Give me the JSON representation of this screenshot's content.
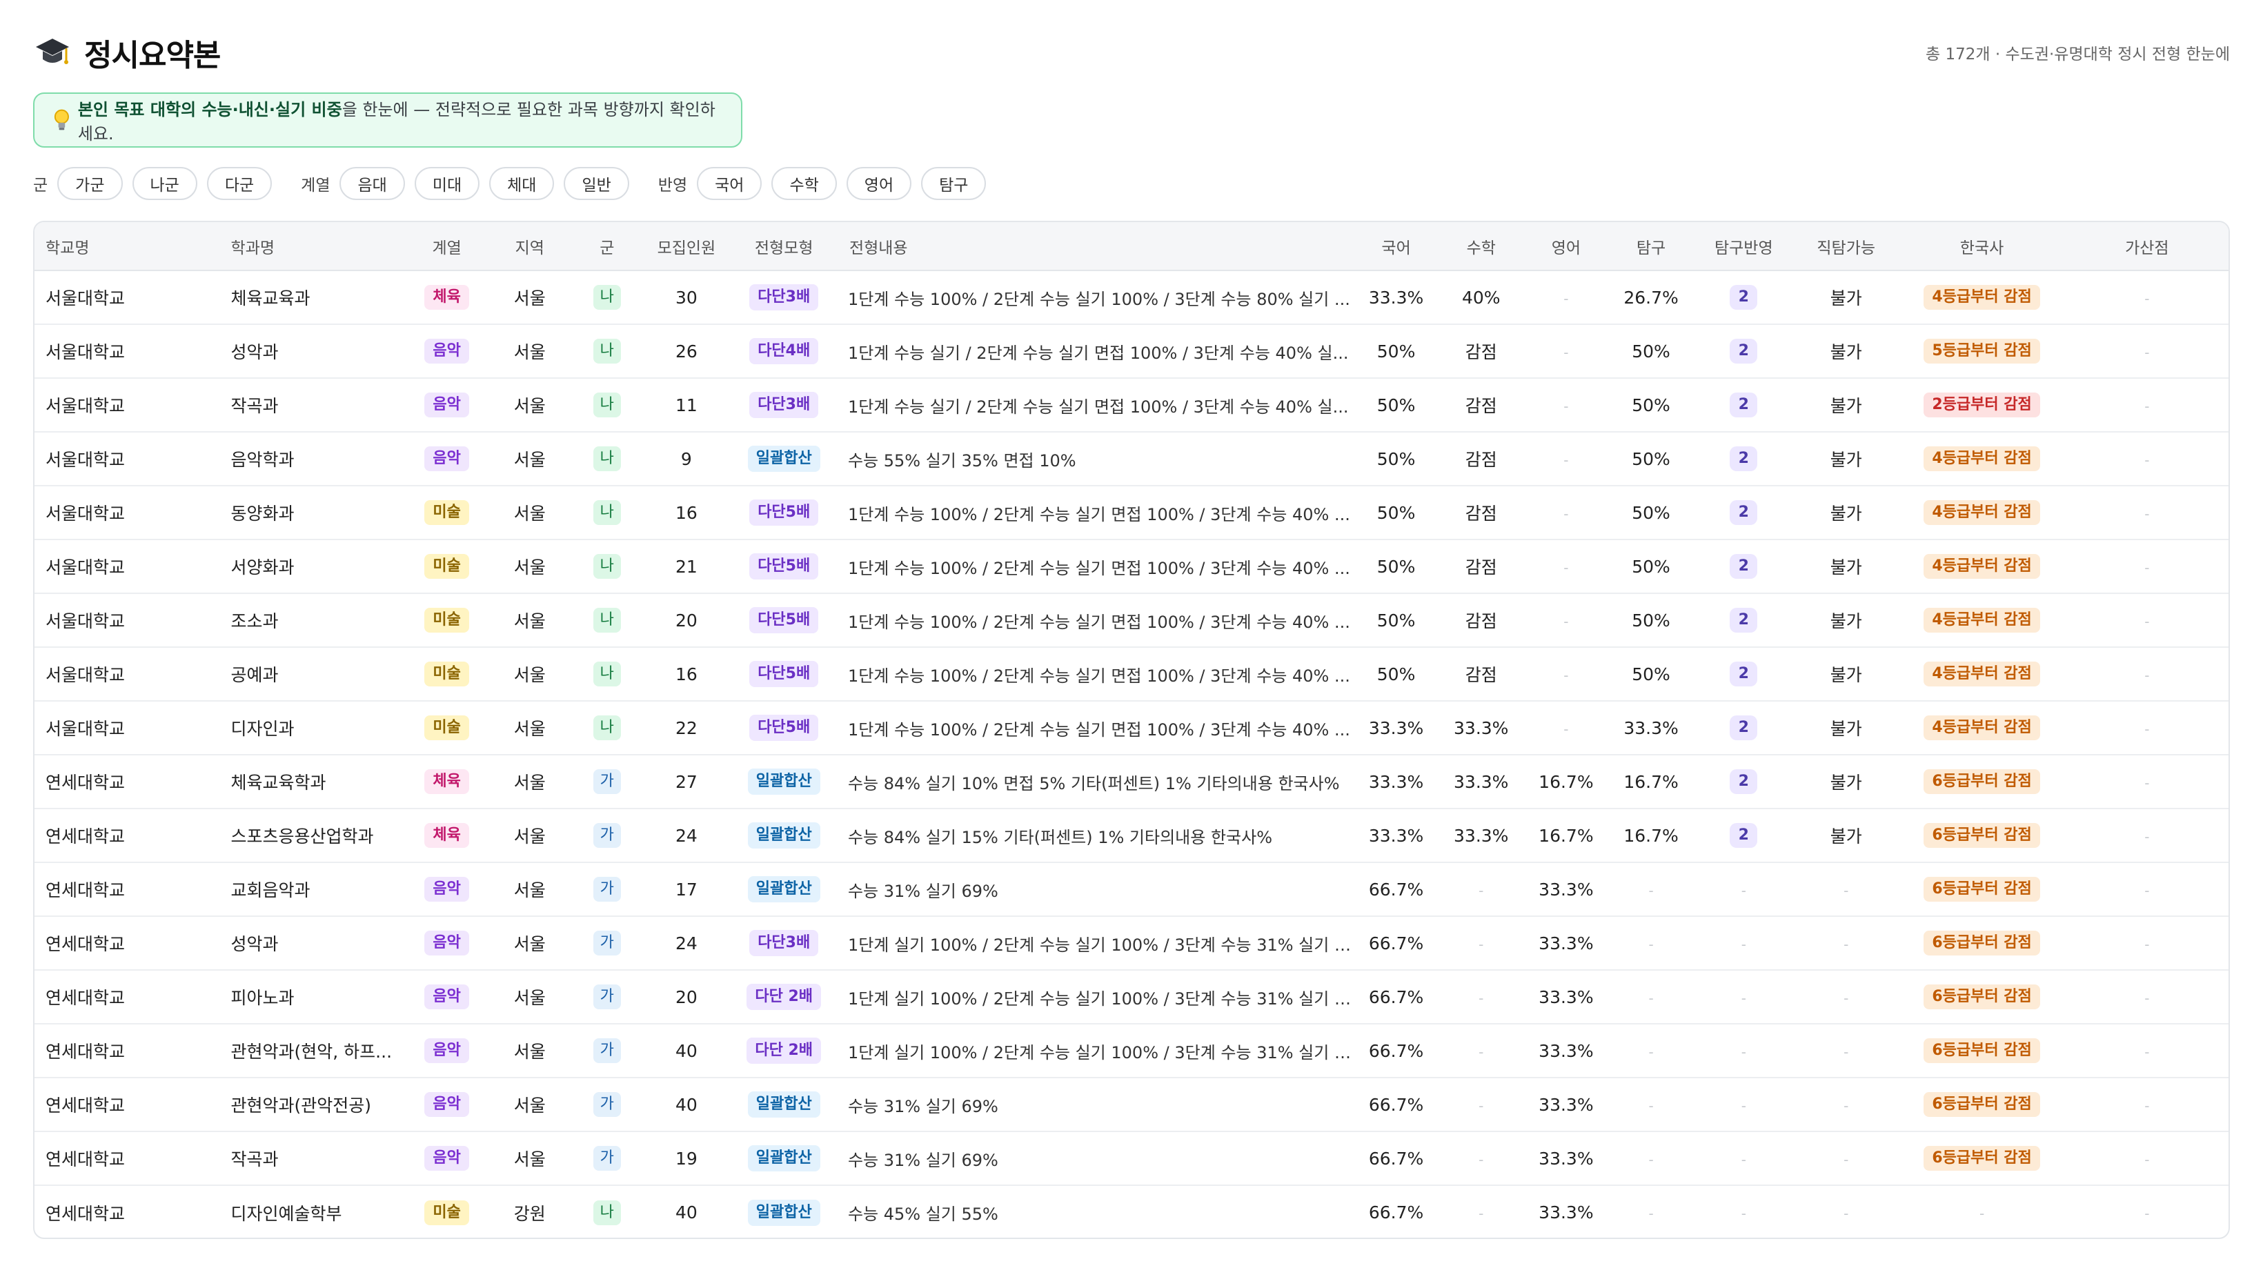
{
  "header": {
    "icon": "graduation-cap-icon",
    "title": "정시요약본",
    "summary": "총 172개 · 수도권·유명대학 정시 전형 한눈에"
  },
  "tip": {
    "icon": "lightbulb-icon",
    "bold": "본인 목표 대학의 수능·내신·실기 비중",
    "rest": "을 한눈에 — 전략적으로 필요한 과목 방향까지 확인하세요."
  },
  "filters": {
    "gun_label": "군",
    "gun": [
      "가군",
      "나군",
      "다군"
    ],
    "field_label": "계열",
    "field": [
      "음대",
      "미대",
      "체대",
      "일반"
    ],
    "reflect_label": "반영",
    "reflect": [
      "국어",
      "수학",
      "영어",
      "탐구"
    ]
  },
  "columns": [
    "학교명",
    "학과명",
    "계열",
    "지역",
    "군",
    "모집인원",
    "전형모형",
    "전형내용",
    "국어",
    "수학",
    "영어",
    "탐구",
    "탐구반영",
    "직탐가능",
    "한국사",
    "가산점"
  ],
  "rows": [
    {
      "school": "서울대학교",
      "dept": "체육교육과",
      "field": "체육",
      "region": "서울",
      "gun": "나",
      "quota": "30",
      "model": "다단3배",
      "desc": "1단계 수능 100% / 2단계 수능 실기 100% / 3단계 수능 80% 실기 ...",
      "kor": "33.3%",
      "math": "40%",
      "eng": "-",
      "inq": "26.7%",
      "inq_n": "2",
      "voc": "불가",
      "hist": "4등급부터 감점",
      "bonus": "-"
    },
    {
      "school": "서울대학교",
      "dept": "성악과",
      "field": "음악",
      "region": "서울",
      "gun": "나",
      "quota": "26",
      "model": "다단4배",
      "desc": "1단계 수능 실기 / 2단계 수능 실기 면접 100% / 3단계 수능 40% 실...",
      "kor": "50%",
      "math": "감점",
      "eng": "-",
      "inq": "50%",
      "inq_n": "2",
      "voc": "불가",
      "hist": "5등급부터 감점",
      "bonus": "-"
    },
    {
      "school": "서울대학교",
      "dept": "작곡과",
      "field": "음악",
      "region": "서울",
      "gun": "나",
      "quota": "11",
      "model": "다단3배",
      "desc": "1단계 수능 실기 / 2단계 수능 실기 면접 100% / 3단계 수능 40% 실...",
      "kor": "50%",
      "math": "감점",
      "eng": "-",
      "inq": "50%",
      "inq_n": "2",
      "voc": "불가",
      "hist": "2등급부터 감점",
      "bonus": "-"
    },
    {
      "school": "서울대학교",
      "dept": "음악학과",
      "field": "음악",
      "region": "서울",
      "gun": "나",
      "quota": "9",
      "model": "일괄합산",
      "desc": "수능 55% 실기 35% 면접 10%",
      "kor": "50%",
      "math": "감점",
      "eng": "-",
      "inq": "50%",
      "inq_n": "2",
      "voc": "불가",
      "hist": "4등급부터 감점",
      "bonus": "-"
    },
    {
      "school": "서울대학교",
      "dept": "동양화과",
      "field": "미술",
      "region": "서울",
      "gun": "나",
      "quota": "16",
      "model": "다단5배",
      "desc": "1단계 수능 100% / 2단계 수능 실기 면접 100% / 3단계 수능 40% ...",
      "kor": "50%",
      "math": "감점",
      "eng": "-",
      "inq": "50%",
      "inq_n": "2",
      "voc": "불가",
      "hist": "4등급부터 감점",
      "bonus": "-"
    },
    {
      "school": "서울대학교",
      "dept": "서양화과",
      "field": "미술",
      "region": "서울",
      "gun": "나",
      "quota": "21",
      "model": "다단5배",
      "desc": "1단계 수능 100% / 2단계 수능 실기 면접 100% / 3단계 수능 40% ...",
      "kor": "50%",
      "math": "감점",
      "eng": "-",
      "inq": "50%",
      "inq_n": "2",
      "voc": "불가",
      "hist": "4등급부터 감점",
      "bonus": "-"
    },
    {
      "school": "서울대학교",
      "dept": "조소과",
      "field": "미술",
      "region": "서울",
      "gun": "나",
      "quota": "20",
      "model": "다단5배",
      "desc": "1단계 수능 100% / 2단계 수능 실기 면접 100% / 3단계 수능 40% ...",
      "kor": "50%",
      "math": "감점",
      "eng": "-",
      "inq": "50%",
      "inq_n": "2",
      "voc": "불가",
      "hist": "4등급부터 감점",
      "bonus": "-"
    },
    {
      "school": "서울대학교",
      "dept": "공예과",
      "field": "미술",
      "region": "서울",
      "gun": "나",
      "quota": "16",
      "model": "다단5배",
      "desc": "1단계 수능 100% / 2단계 수능 실기 면접 100% / 3단계 수능 40% ...",
      "kor": "50%",
      "math": "감점",
      "eng": "-",
      "inq": "50%",
      "inq_n": "2",
      "voc": "불가",
      "hist": "4등급부터 감점",
      "bonus": "-"
    },
    {
      "school": "서울대학교",
      "dept": "디자인과",
      "field": "미술",
      "region": "서울",
      "gun": "나",
      "quota": "22",
      "model": "다단5배",
      "desc": "1단계 수능 100% / 2단계 수능 실기 면접 100% / 3단계 수능 40% ...",
      "kor": "33.3%",
      "math": "33.3%",
      "eng": "-",
      "inq": "33.3%",
      "inq_n": "2",
      "voc": "불가",
      "hist": "4등급부터 감점",
      "bonus": "-"
    },
    {
      "school": "연세대학교",
      "dept": "체육교육학과",
      "field": "체육",
      "region": "서울",
      "gun": "가",
      "quota": "27",
      "model": "일괄합산",
      "desc": "수능 84% 실기 10% 면접 5% 기타(퍼센트) 1% 기타의내용 한국사%",
      "kor": "33.3%",
      "math": "33.3%",
      "eng": "16.7%",
      "inq": "16.7%",
      "inq_n": "2",
      "voc": "불가",
      "hist": "6등급부터 감점",
      "bonus": "-"
    },
    {
      "school": "연세대학교",
      "dept": "스포츠응용산업학과",
      "field": "체육",
      "region": "서울",
      "gun": "가",
      "quota": "24",
      "model": "일괄합산",
      "desc": "수능 84% 실기 15% 기타(퍼센트) 1% 기타의내용 한국사%",
      "kor": "33.3%",
      "math": "33.3%",
      "eng": "16.7%",
      "inq": "16.7%",
      "inq_n": "2",
      "voc": "불가",
      "hist": "6등급부터 감점",
      "bonus": "-"
    },
    {
      "school": "연세대학교",
      "dept": "교회음악과",
      "field": "음악",
      "region": "서울",
      "gun": "가",
      "quota": "17",
      "model": "일괄합산",
      "desc": "수능 31% 실기 69%",
      "kor": "66.7%",
      "math": "-",
      "eng": "33.3%",
      "inq": "-",
      "inq_n": "-",
      "voc": "-",
      "hist": "6등급부터 감점",
      "bonus": "-"
    },
    {
      "school": "연세대학교",
      "dept": "성악과",
      "field": "음악",
      "region": "서울",
      "gun": "가",
      "quota": "24",
      "model": "다단3배",
      "desc": "1단계 실기 100% / 2단계 수능 실기 100% / 3단계 수능 31% 실기 6...",
      "kor": "66.7%",
      "math": "-",
      "eng": "33.3%",
      "inq": "-",
      "inq_n": "-",
      "voc": "-",
      "hist": "6등급부터 감점",
      "bonus": "-"
    },
    {
      "school": "연세대학교",
      "dept": "피아노과",
      "field": "음악",
      "region": "서울",
      "gun": "가",
      "quota": "20",
      "model": "다단 2배",
      "desc": "1단계 실기 100% / 2단계 수능 실기 100% / 3단계 수능 31% 실기 6...",
      "kor": "66.7%",
      "math": "-",
      "eng": "33.3%",
      "inq": "-",
      "inq_n": "-",
      "voc": "-",
      "hist": "6등급부터 감점",
      "bonus": "-"
    },
    {
      "school": "연세대학교",
      "dept": "관현악과(현악, 하프...",
      "field": "음악",
      "region": "서울",
      "gun": "가",
      "quota": "40",
      "model": "다단 2배",
      "desc": "1단계 실기 100% / 2단계 수능 실기 100% / 3단계 수능 31% 실기 6...",
      "kor": "66.7%",
      "math": "-",
      "eng": "33.3%",
      "inq": "-",
      "inq_n": "-",
      "voc": "-",
      "hist": "6등급부터 감점",
      "bonus": "-"
    },
    {
      "school": "연세대학교",
      "dept": "관현악과(관악전공)",
      "field": "음악",
      "region": "서울",
      "gun": "가",
      "quota": "40",
      "model": "일괄합산",
      "desc": "수능 31% 실기 69%",
      "kor": "66.7%",
      "math": "-",
      "eng": "33.3%",
      "inq": "-",
      "inq_n": "-",
      "voc": "-",
      "hist": "6등급부터 감점",
      "bonus": "-"
    },
    {
      "school": "연세대학교",
      "dept": "작곡과",
      "field": "음악",
      "region": "서울",
      "gun": "가",
      "quota": "19",
      "model": "일괄합산",
      "desc": "수능 31% 실기 69%",
      "kor": "66.7%",
      "math": "-",
      "eng": "33.3%",
      "inq": "-",
      "inq_n": "-",
      "voc": "-",
      "hist": "6등급부터 감점",
      "bonus": "-"
    },
    {
      "school": "연세대학교",
      "dept": "디자인예술학부",
      "field": "미술",
      "region": "강원",
      "gun": "나",
      "quota": "40",
      "model": "일괄합산",
      "desc": "수능 45% 실기 55%",
      "kor": "66.7%",
      "math": "-",
      "eng": "33.3%",
      "inq": "-",
      "inq_n": "-",
      "voc": "-",
      "hist": "-",
      "bonus": "-"
    }
  ]
}
